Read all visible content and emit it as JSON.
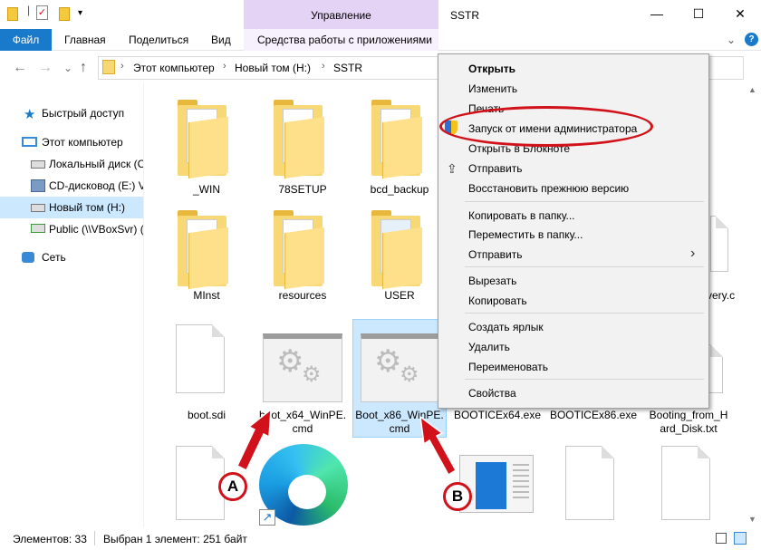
{
  "titlebar": {
    "manage_label": "Управление",
    "title": "SSTR",
    "minimize": "—",
    "maximize": "☐",
    "close": "✕"
  },
  "ribbon": {
    "file": "Файл",
    "home": "Главная",
    "share": "Поделиться",
    "view": "Вид",
    "app_tools": "Средства работы с приложениями",
    "expand": "⌄",
    "help": "?"
  },
  "nav": {
    "back": "←",
    "forward": "→",
    "recent": "⌄",
    "up": "↑",
    "sep": "›",
    "path": [
      "Этот компьютер",
      "Новый том (H:)",
      "SSTR"
    ]
  },
  "sidebar": [
    {
      "label": "Быстрый доступ"
    },
    {
      "label": "Этот компьютер"
    },
    {
      "label": "Локальный диск (C"
    },
    {
      "label": "CD-дисковод (E:) V"
    },
    {
      "label": "Новый том (H:)"
    },
    {
      "label": "Public (\\\\VBoxSvr) ("
    },
    {
      "label": "Сеть"
    }
  ],
  "items": {
    "win": "_WIN",
    "setup78": "78SETUP",
    "bcd": "bcd_backup",
    "minst": "MInst",
    "resources": "resources",
    "user": "USER",
    "very": "very.c",
    "boot_sdi": "boot.sdi",
    "boot_x64_1": "boot_x64_WinPE.",
    "boot_x64_2": "cmd",
    "boot_x86_1": "Boot_x86_WinPE.",
    "boot_x86_2": "cmd",
    "bootice64": "BOOTICEx64.exe",
    "bootice86": "BOOTICEx86.exe",
    "booting_1": "Booting_from_H",
    "booting_2": "ard_Disk.txt"
  },
  "context_menu": {
    "open": "Открыть",
    "edit": "Изменить",
    "print": "Печать",
    "run_as_admin": "Запуск от имени администратора",
    "open_notepad": "Открыть в Блокноте",
    "share": "Отправить",
    "restore": "Восстановить прежнюю версию",
    "copy_to": "Копировать в папку...",
    "move_to": "Переместить в папку...",
    "send_to": "Отправить",
    "cut": "Вырезать",
    "copy": "Копировать",
    "create_shortcut": "Создать ярлык",
    "delete": "Удалить",
    "rename": "Переименовать",
    "properties": "Свойства",
    "submenu_arrow": "›"
  },
  "annotations": {
    "a": "A",
    "b": "B",
    "color": "#d1121a"
  },
  "status": {
    "count": "Элементов: 33",
    "selected": "Выбран 1 элемент: 251 байт"
  },
  "colors": {
    "accent": "#1979ca",
    "selection": "#cce8ff",
    "manage_tab": "#e5d3f5"
  }
}
